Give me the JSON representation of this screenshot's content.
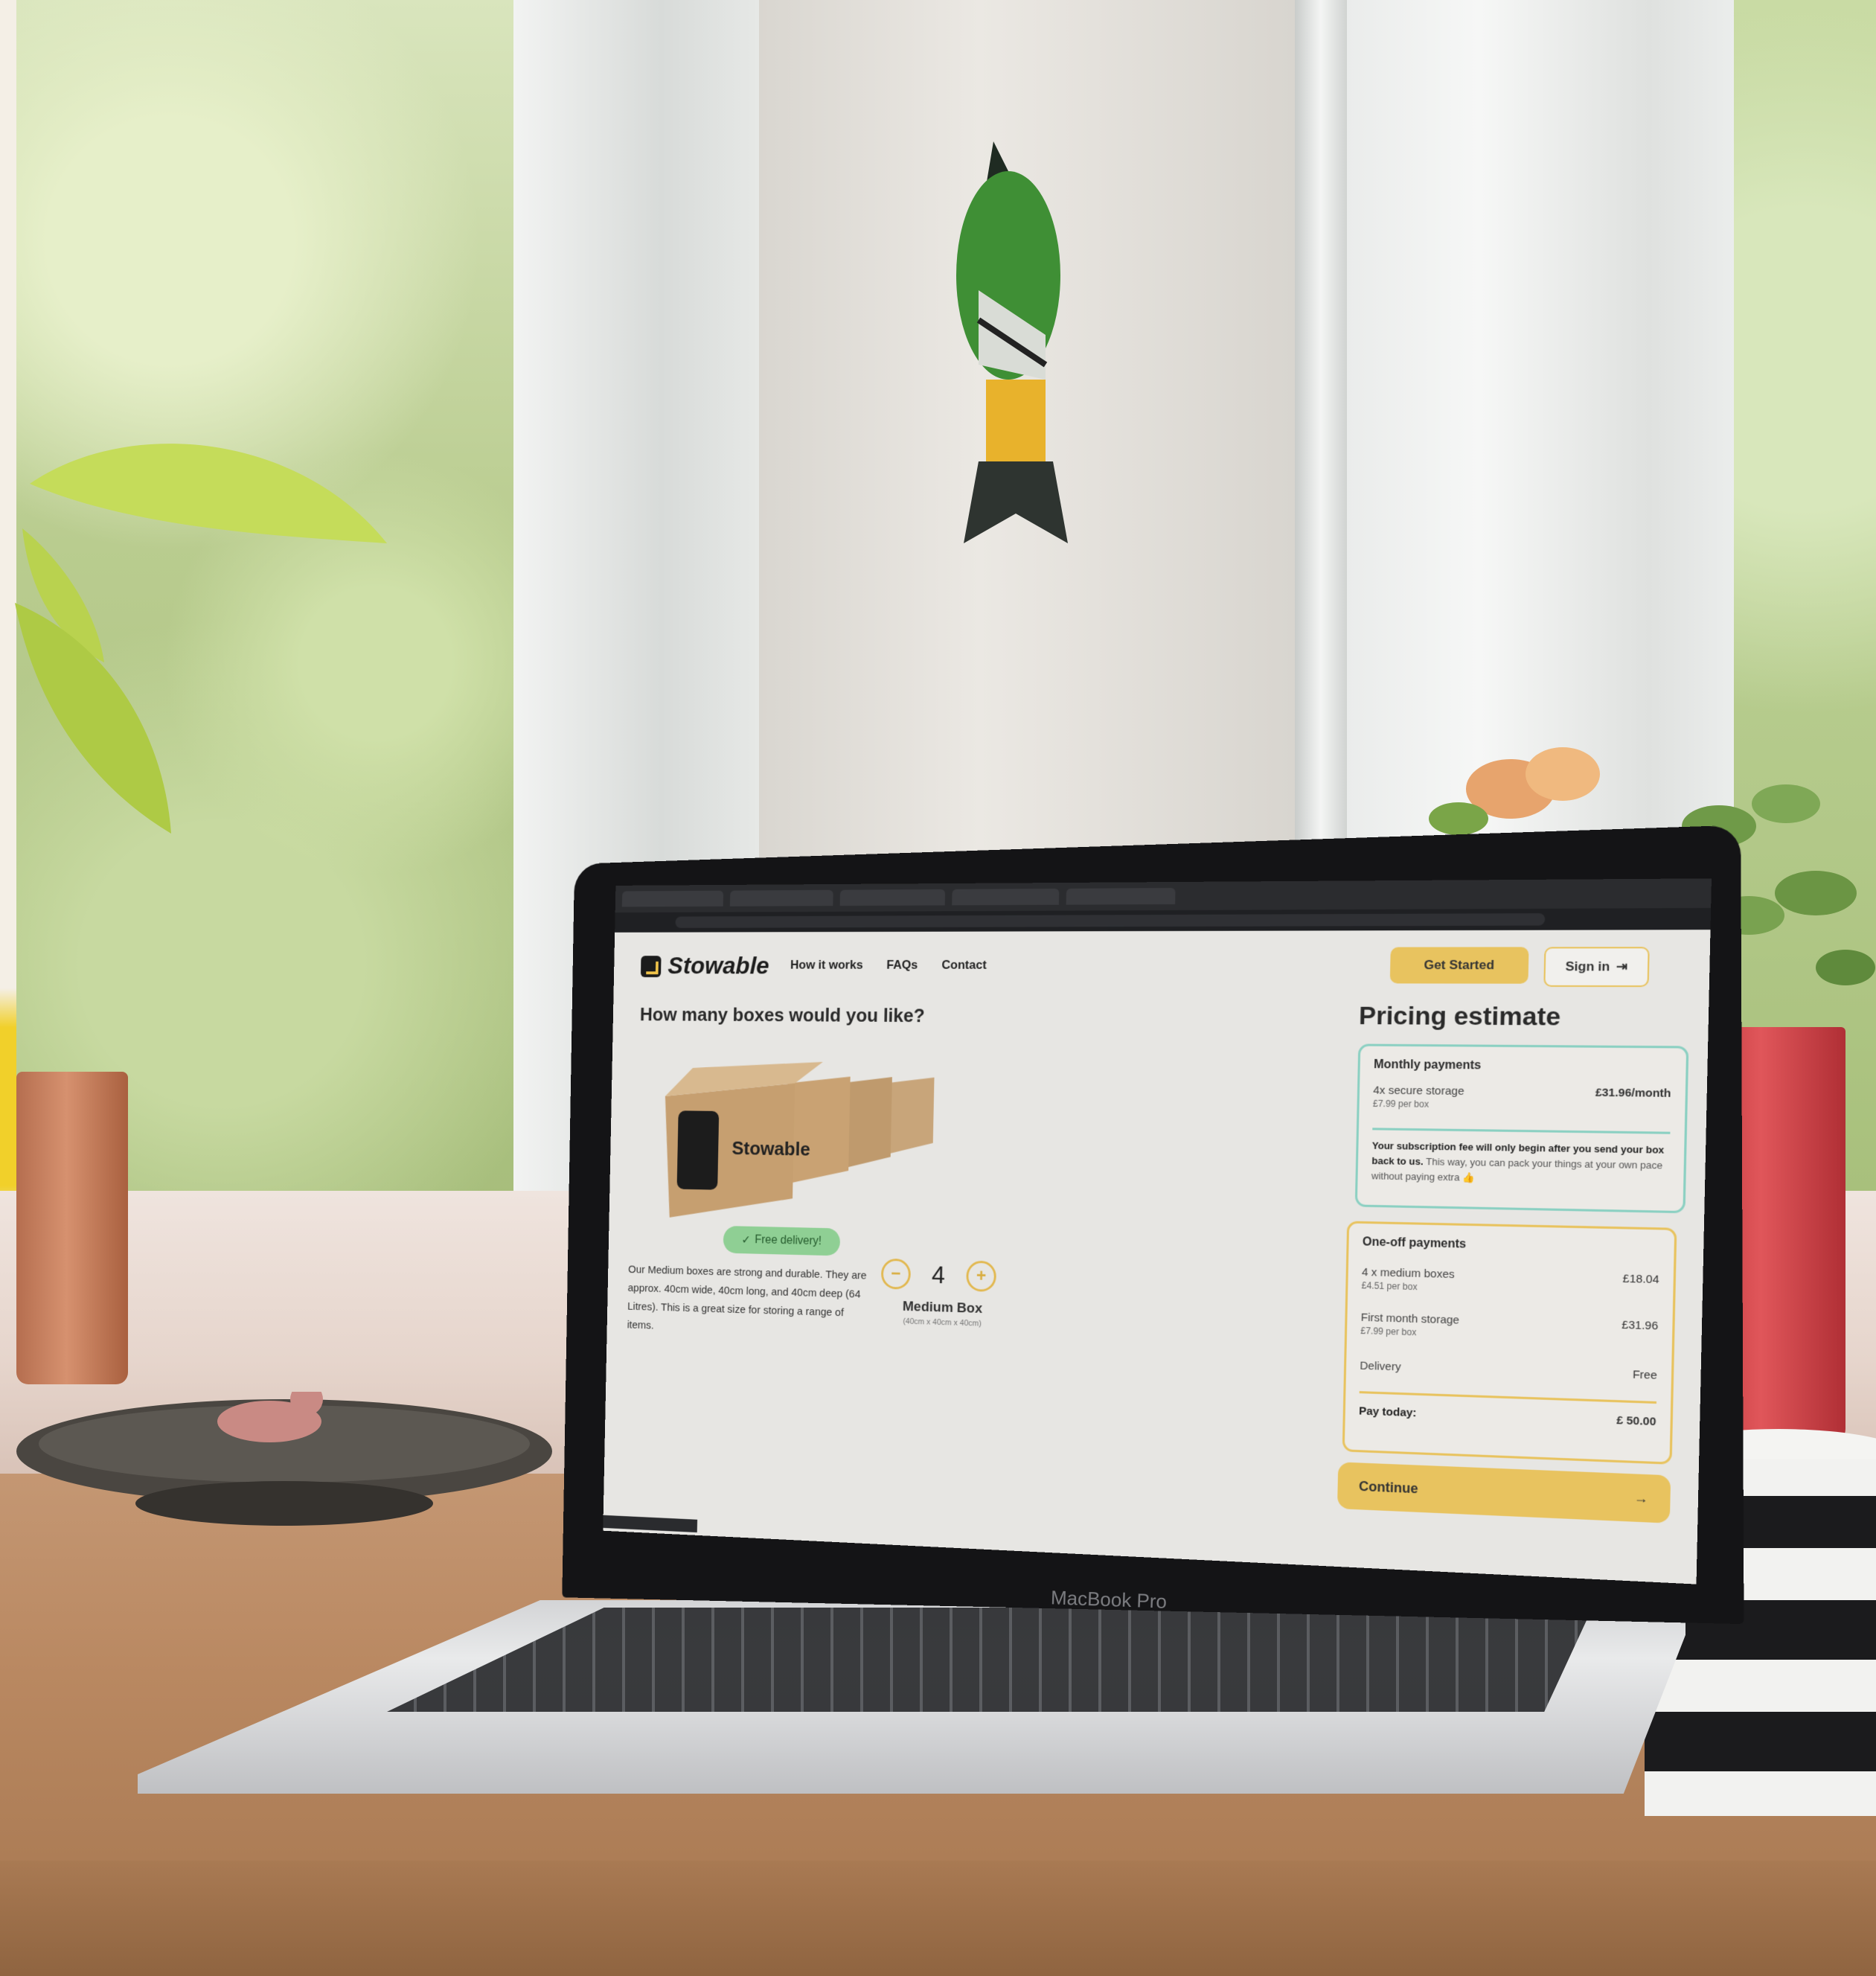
{
  "colors": {
    "accent": "#e8c35f",
    "teal": "#8bd0c2",
    "green": "#8fcf94",
    "page_bg": "#e7e6e3"
  },
  "nav": {
    "brand": "Stowable",
    "links": [
      "How it works",
      "FAQs",
      "Contact"
    ],
    "get_started": "Get Started",
    "sign_in": "Sign in"
  },
  "main": {
    "question": "How many boxes would you like?",
    "box_logo": "Stowable",
    "free_delivery": "Free delivery!",
    "description": "Our Medium boxes are strong and durable. They are approx. 40cm wide, 40cm long, and 40cm deep (64 Litres). This is a great size for storing a range of items.",
    "quantity": "4",
    "box_name": "Medium Box",
    "box_dims": "(40cm x 40cm x 40cm)"
  },
  "pricing": {
    "title": "Pricing estimate",
    "monthly": {
      "heading": "Monthly payments",
      "item_label": "4x secure storage",
      "item_sub": "£7.99 per box",
      "item_amount": "£31.96/month",
      "note_bold": "Your subscription fee will only begin after you send your box back to us.",
      "note_rest": "This way, you can pack your things at your own pace without paying extra 👍"
    },
    "oneoff": {
      "heading": "One-off payments",
      "rows": [
        {
          "label": "4 x medium boxes",
          "sub": "£4.51 per box",
          "amount": "£18.04"
        },
        {
          "label": "First month storage",
          "sub": "£7.99 per box",
          "amount": "£31.96"
        },
        {
          "label": "Delivery",
          "sub": "",
          "amount": "Free"
        }
      ],
      "total_label": "Pay today:",
      "total_amount": "£ 50.00"
    },
    "continue": "Continue"
  },
  "device_label": "MacBook Pro",
  "icons": [
    "stowable-logo-icon",
    "sign-in-icon",
    "check-circle-icon",
    "minus-circle-icon",
    "plus-circle-icon",
    "arrow-right-icon"
  ]
}
